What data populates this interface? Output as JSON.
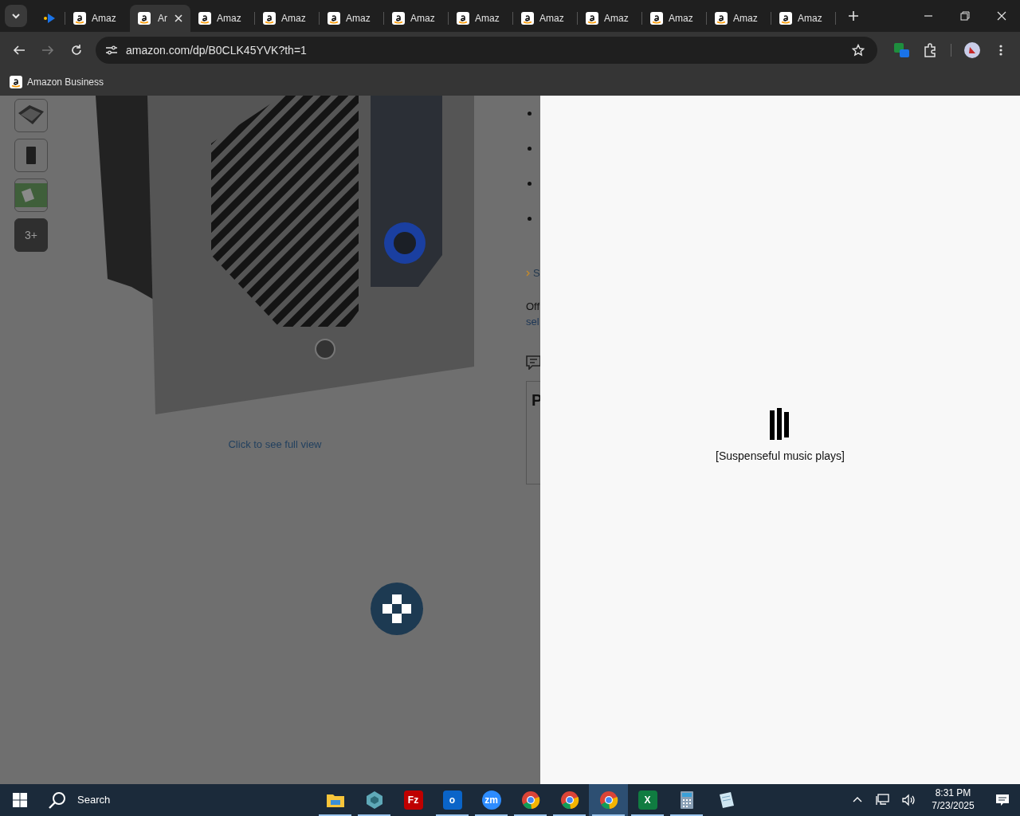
{
  "browser": {
    "tabs": [
      {
        "kind": "media",
        "selected": false
      },
      {
        "kind": "amazon",
        "label": "Amaz",
        "selected": false
      },
      {
        "kind": "amazon",
        "label": "Ar",
        "selected": true
      },
      {
        "kind": "amazon",
        "label": "Amaz",
        "selected": false
      },
      {
        "kind": "amazon",
        "label": "Amaz",
        "selected": false
      },
      {
        "kind": "amazon",
        "label": "Amaz",
        "selected": false
      },
      {
        "kind": "amazon",
        "label": "Amaz",
        "selected": false
      },
      {
        "kind": "amazon",
        "label": "Amaz",
        "selected": false
      },
      {
        "kind": "amazon",
        "label": "Amaz",
        "selected": false
      },
      {
        "kind": "amazon",
        "label": "Amaz",
        "selected": false
      },
      {
        "kind": "amazon",
        "label": "Amaz",
        "selected": false
      },
      {
        "kind": "amazon",
        "label": "Amaz",
        "selected": false
      },
      {
        "kind": "amazon",
        "label": "Amaz",
        "selected": false
      }
    ],
    "address_bar": {
      "url": "amazon.com/dp/B0CLK45YVK?th=1",
      "forward_disabled": true
    },
    "bookmarks": [
      {
        "label": "Amazon Business"
      }
    ]
  },
  "page": {
    "thumbnails": [
      {
        "kind": "device"
      },
      {
        "kind": "tall"
      },
      {
        "kind": "outdoor"
      },
      {
        "kind": "more",
        "label": "3+"
      }
    ],
    "image_caption": "Click to see full view",
    "fragments": [
      {
        "kind": "link-chevron",
        "text": "S"
      },
      {
        "kind": "text",
        "text": "Off"
      },
      {
        "kind": "link",
        "text": "sel"
      },
      {
        "kind": "chat-icon"
      },
      {
        "kind": "heading",
        "text": "P"
      }
    ]
  },
  "caption_panel": {
    "text": "[Suspenseful music plays]"
  },
  "taskbar": {
    "search_label": "Search",
    "apps": [
      {
        "kind": "folder",
        "running": true,
        "selected": false
      },
      {
        "kind": "hex",
        "running": true,
        "selected": false
      },
      {
        "kind": "filezilla",
        "glyph": "Fz",
        "running": false,
        "selected": false
      },
      {
        "kind": "outlook",
        "glyph": "o",
        "running": true,
        "selected": false
      },
      {
        "kind": "zoom",
        "glyph": "zm",
        "running": true,
        "selected": false
      },
      {
        "kind": "chrome",
        "running": true,
        "selected": false
      },
      {
        "kind": "chrome",
        "running": true,
        "selected": false
      },
      {
        "kind": "chrome",
        "running": true,
        "selected": true
      },
      {
        "kind": "excel",
        "glyph": "X",
        "running": true,
        "selected": false
      },
      {
        "kind": "calculator",
        "running": true,
        "selected": false
      },
      {
        "kind": "notepad",
        "running": false,
        "selected": false
      }
    ],
    "clock": {
      "time": "8:31 PM",
      "date": "7/23/2025"
    }
  }
}
